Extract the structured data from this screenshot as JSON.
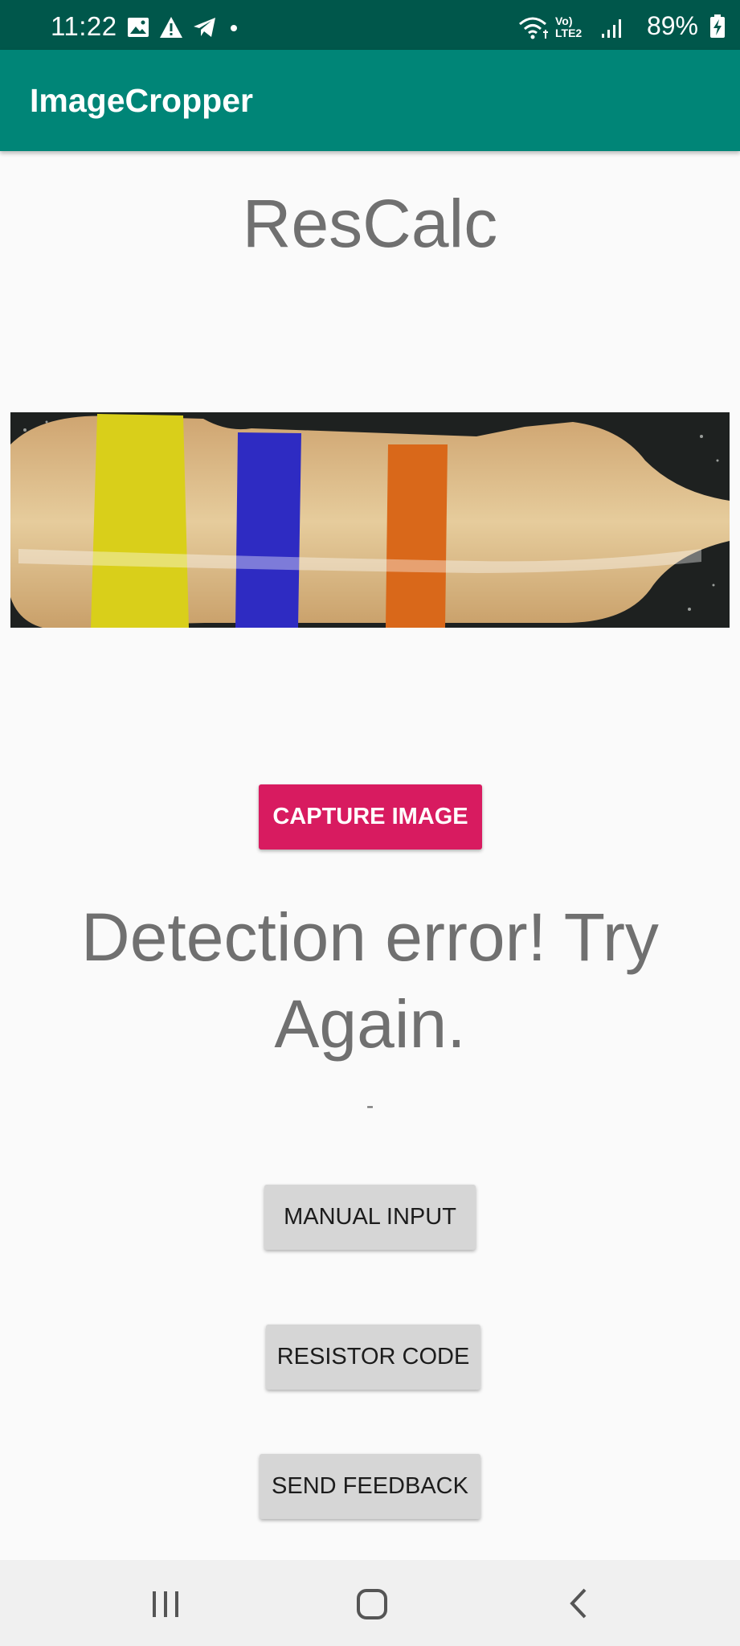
{
  "status_bar": {
    "time": "11:22",
    "left_icons": [
      "image-icon",
      "alert-icon",
      "telegram-icon",
      "dot-icon"
    ],
    "network_label": "Vo) LTE2",
    "battery_percent": "89%"
  },
  "app_bar": {
    "title": "ImageCropper",
    "color": "#008577"
  },
  "main": {
    "heading": "ResCalc",
    "resistor_image_alt": "resistor-photo",
    "capture_button_label": "CAPTURE IMAGE",
    "result_text": "Detection error! Try Again.",
    "result_subtext": "-",
    "manual_input_label": "MANUAL INPUT",
    "resistor_code_label": "RESISTOR CODE",
    "send_feedback_label": "SEND FEEDBACK"
  },
  "colors": {
    "accent": "#d81b60",
    "primary_dark": "#00574b",
    "text_gray": "#707070"
  },
  "nav_bar": {
    "icons": [
      "recent-apps-icon",
      "home-icon",
      "back-icon"
    ]
  }
}
